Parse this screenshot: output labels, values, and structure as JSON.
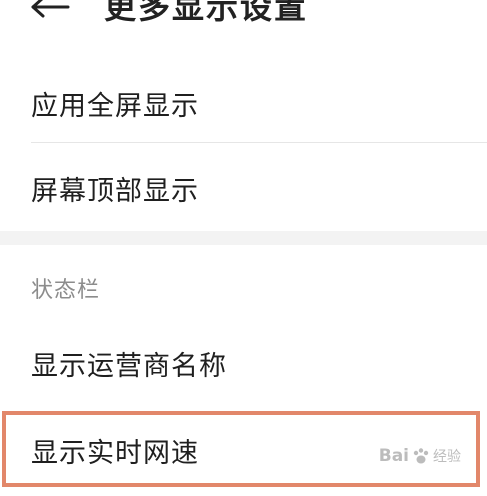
{
  "header": {
    "title": "更多显示设置"
  },
  "items": [
    {
      "label": "应用全屏显示"
    },
    {
      "label": "屏幕顶部显示"
    }
  ],
  "status_bar_section": {
    "header": "状态栏",
    "items": [
      {
        "label": "显示运营商名称"
      },
      {
        "label": "显示实时网速"
      }
    ]
  },
  "watermark": {
    "brand": "Bai",
    "sub": "经验"
  },
  "colors": {
    "highlight": "#e2876a",
    "section_gap": "#f3f3f3",
    "section_header_text": "#8c8c8c"
  }
}
